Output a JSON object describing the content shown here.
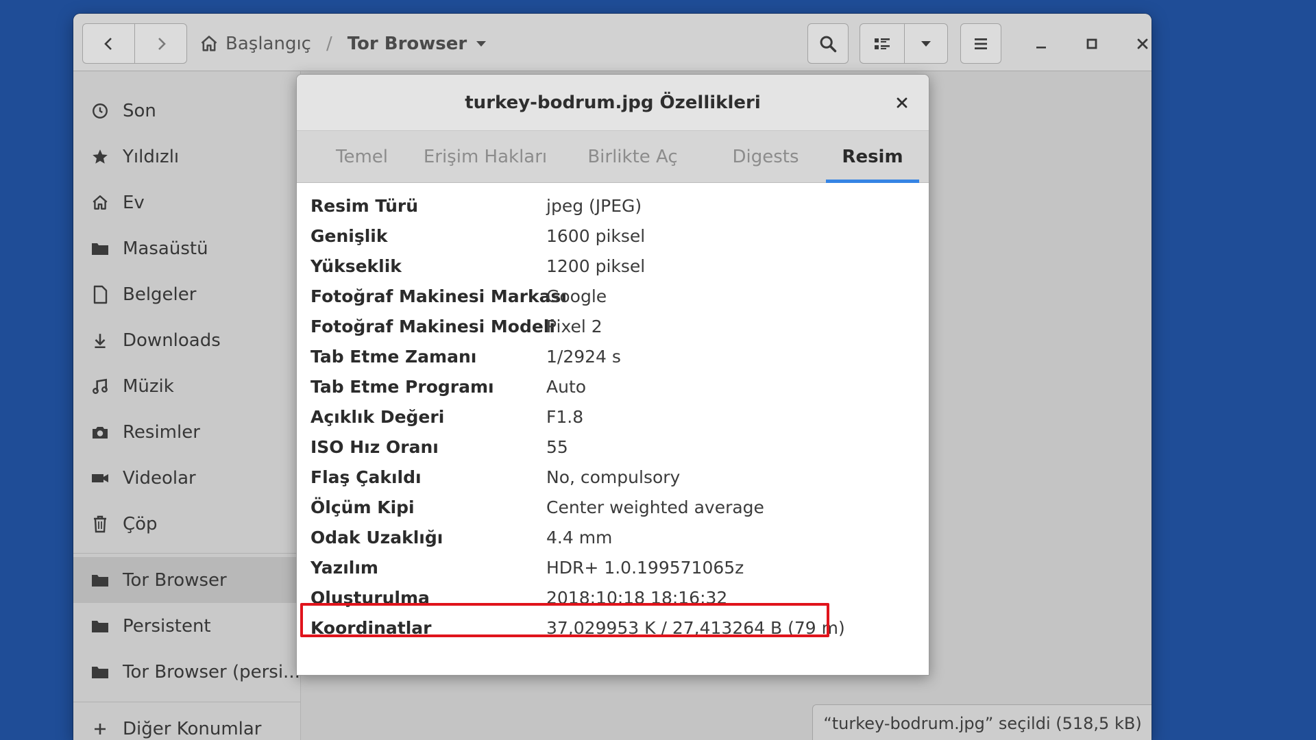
{
  "headerbar": {
    "back_icon": "chevron-left-icon",
    "forward_icon": "chevron-right-icon",
    "home_crumb": "Başlangıç",
    "separator": "/",
    "current_crumb": "Tor Browser"
  },
  "sidebar": {
    "items": [
      {
        "label": "Son",
        "icon": "clock-icon"
      },
      {
        "label": "Yıldızlı",
        "icon": "star-icon"
      },
      {
        "label": "Ev",
        "icon": "home-icon"
      },
      {
        "label": "Masaüstü",
        "icon": "folder-icon"
      },
      {
        "label": "Belgeler",
        "icon": "document-icon"
      },
      {
        "label": "Downloads",
        "icon": "download-icon"
      },
      {
        "label": "Müzik",
        "icon": "music-icon"
      },
      {
        "label": "Resimler",
        "icon": "camera-icon"
      },
      {
        "label": "Videolar",
        "icon": "video-icon"
      },
      {
        "label": "Çöp",
        "icon": "trash-icon"
      }
    ],
    "bookmarks": [
      {
        "label": "Tor Browser",
        "icon": "folder-icon",
        "active": true
      },
      {
        "label": "Persistent",
        "icon": "folder-icon"
      },
      {
        "label": "Tor Browser (persi...",
        "icon": "folder-icon"
      }
    ],
    "other_locations": "Diğer Konumlar"
  },
  "dialog": {
    "title": "turkey-bodrum.jpg Özellikleri",
    "tabs": [
      "Temel",
      "Erişim Hakları",
      "Birlikte Aç",
      "Digests",
      "Resim"
    ],
    "active_tab": "Resim",
    "properties": [
      {
        "key": "Resim Türü",
        "value": "jpeg (JPEG)"
      },
      {
        "key": "Genişlik",
        "value": "1600 piksel"
      },
      {
        "key": "Yükseklik",
        "value": "1200 piksel"
      },
      {
        "key": "Fotoğraf Makinesi Markası",
        "value": "Google"
      },
      {
        "key": "Fotoğraf Makinesi Modeli",
        "value": "Pixel 2"
      },
      {
        "key": "Tab Etme Zamanı",
        "value": "1/2924 s"
      },
      {
        "key": "Tab Etme Programı",
        "value": "Auto"
      },
      {
        "key": "Açıklık Değeri",
        "value": "F1.8"
      },
      {
        "key": "ISO Hız Oranı",
        "value": "55"
      },
      {
        "key": "Flaş Çakıldı",
        "value": "No, compulsory"
      },
      {
        "key": "Ölçüm Kipi",
        "value": "Center weighted average"
      },
      {
        "key": "Odak Uzaklığı",
        "value": "4.4 mm"
      },
      {
        "key": "Yazılım",
        "value": "HDR+ 1.0.199571065z"
      },
      {
        "key": "Oluşturulma",
        "value": "2018:10:18 18:16:32"
      },
      {
        "key": "Koordinatlar",
        "value": "37,029953 K / 27,413264 B (79 m)"
      }
    ]
  },
  "statusbar": {
    "text": "“turkey-bodrum.jpg” seçildi  (518,5 kB)"
  },
  "colors": {
    "desktop": "#1f4d97",
    "accent": "#3584e4",
    "highlight": "#e0141c"
  }
}
